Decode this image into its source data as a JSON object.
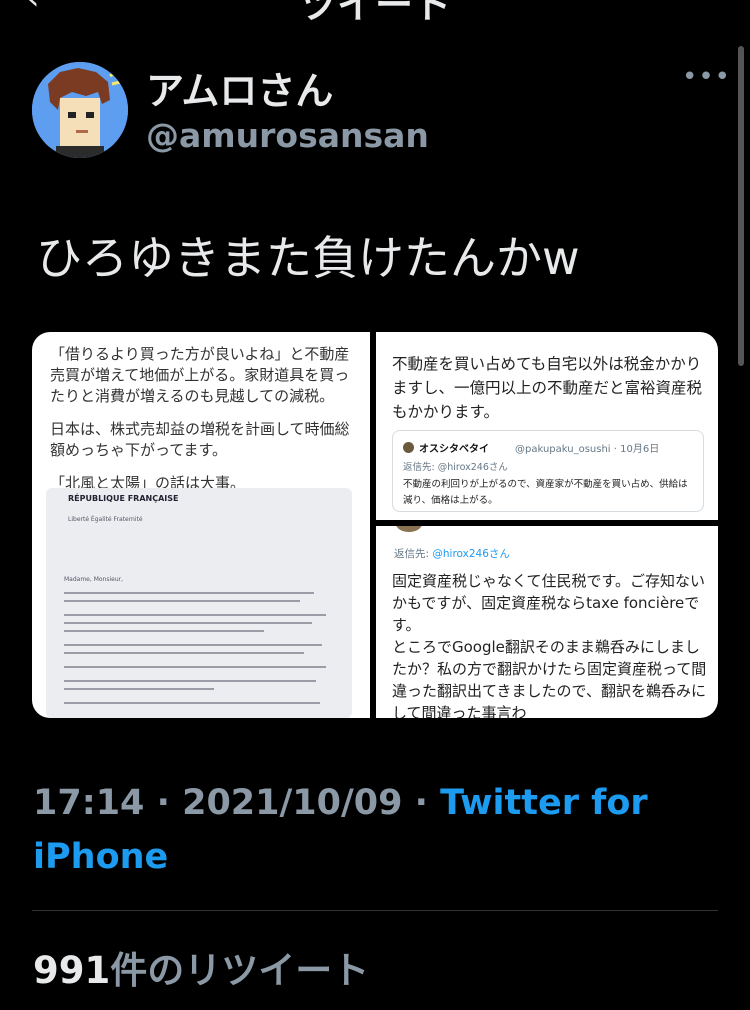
{
  "header": {
    "back_icon": "chevron-left-icon",
    "title": "ツイート"
  },
  "author": {
    "name": "アムロさん",
    "handle": "@amurosansan",
    "avatar_icon": "pixel-avatar"
  },
  "more_icon": "more-horizontal-icon",
  "tweet": {
    "text": "ひろゆきまた負けたんかw"
  },
  "media": {
    "panel1": {
      "lines": [
        "「借りるより買った方が良いよね」と不動産売買が増えて地価が上がる。家財道具を買ったりと消費が増えるのも見越しての減税。",
        "日本は、株式売却益の増税を計画して時価総額めっちゃ下がってます。",
        "「北風と太陽」の話は大事。"
      ],
      "letter_header": "RÉPUBLIQUE FRANÇAISE",
      "letter_motto": "Liberté Égalité Fraternité",
      "letter_greeting": "Madame, Monsieur,"
    },
    "panel2": {
      "text": "不動産を買い占めても自宅以外は税金かかりますし、一億円以上の不動産だと富裕資産税もかかります。",
      "quote": {
        "name": "オスシタベタイ",
        "handle": "@pakupaku_osushi · 10月6日",
        "reply_prefix": "返信先:",
        "reply_to": "@hirox246さん",
        "body": "不動産の利回りが上がるので、資産家が不動産を買い占め、供給は減り、価格は上がる。"
      }
    },
    "panel3": {
      "reply_prefix": "返信先:",
      "reply_to": "@hirox246さん",
      "text": "固定資産税じゃなくて住民税です。ご存知ないかもですが、固定資産税ならtaxe foncièreです。\nところでGoogle翻訳そのまま鵜呑みにしましたか？私の方で翻訳かけたら固定資産税って間違った翻訳出てきましたので、翻訳を鵜呑みにして間違った事言わ"
    }
  },
  "meta": {
    "time": "17:14",
    "sep1": " · ",
    "date": "2021/10/09",
    "sep2": " · ",
    "source": "Twitter for iPhone"
  },
  "stats": {
    "retweet_count": "991",
    "retweet_label": "件のリツイート"
  },
  "colors": {
    "background": "#000000",
    "text": "#e7e9ea",
    "muted": "#8b98a5",
    "accent": "#1d9bf0",
    "divider": "#2f3336"
  }
}
